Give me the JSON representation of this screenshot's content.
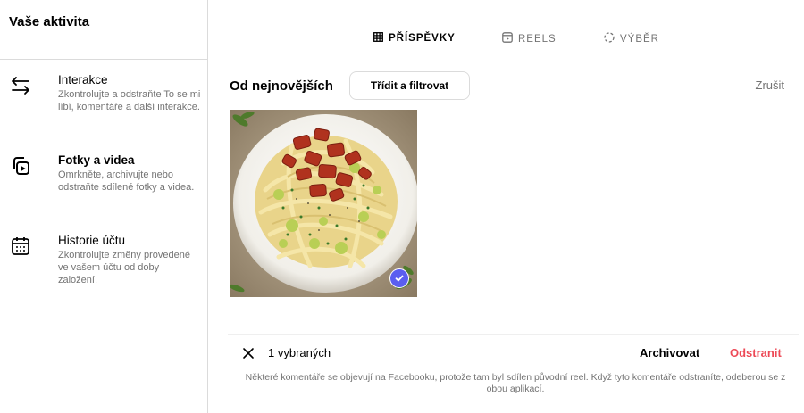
{
  "sidebar": {
    "title": "Vaše aktivita",
    "items": [
      {
        "label": "Interakce",
        "description": "Zkontrolujte a odstraňte To se mi líbí, komentáře a další interakce.",
        "icon": "arrows-exchange-icon"
      },
      {
        "label": "Fotky a videa",
        "description": "Omrkněte, archivujte nebo odstraňte sdílené fotky a videa.",
        "icon": "photos-videos-icon"
      },
      {
        "label": "Historie účtu",
        "description": "Zkontrolujte změny provedené ve vašem účtu od doby založení.",
        "icon": "calendar-icon"
      }
    ]
  },
  "tabs": [
    {
      "label": "PŘÍSPĚVKY",
      "icon": "grid-icon",
      "active": true
    },
    {
      "label": "REELS",
      "icon": "reels-icon",
      "active": false
    },
    {
      "label": "VÝBĚR",
      "icon": "dashed-circle-icon",
      "active": false
    }
  ],
  "sort": {
    "label": "Od nejnovějších",
    "button_label": "Třídit a filtrovat",
    "cancel_label": "Zrušit"
  },
  "post": {
    "selected": true,
    "check_color": "#5b5ef0"
  },
  "actions": {
    "selected_count": "1 vybraných",
    "archive_label": "Archivovat",
    "delete_label": "Odstranit",
    "delete_color": "#ed4956",
    "note": "Některé komentáře se objevují na Facebooku, protože tam byl sdílen původní reel. Když tyto komentáře odstraníte, odeberou se z obou aplikací."
  }
}
